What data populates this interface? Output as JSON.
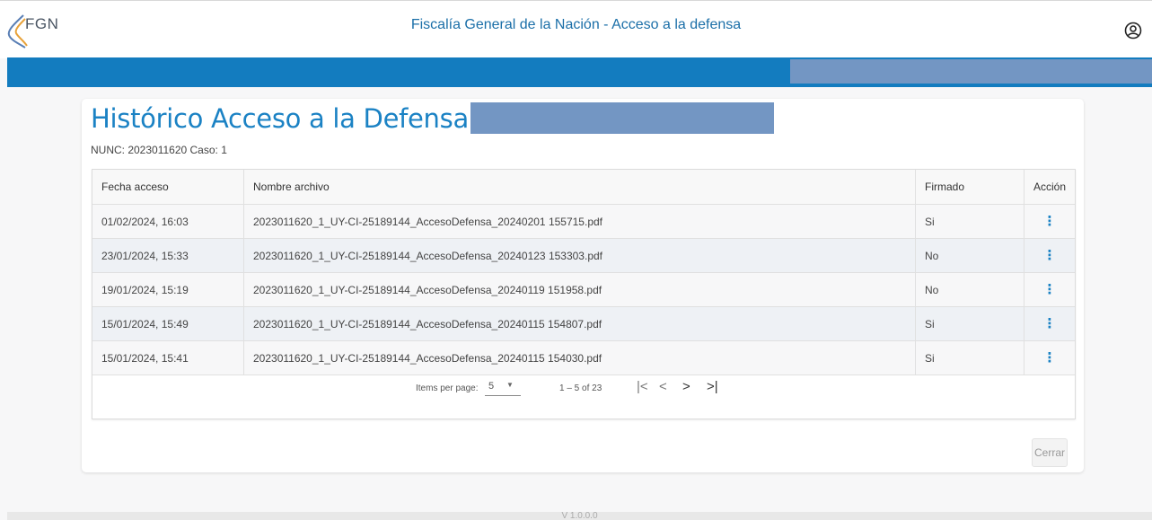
{
  "header": {
    "logo_text": "FGN",
    "title": "Fiscalía General de la Nación - Acceso a la defensa",
    "user_icon": "account-circle-icon"
  },
  "card": {
    "title": "Histórico Acceso a la Defensa para:",
    "subline": "NUNC: 2023011620 Caso: 1",
    "close_label": "Cerrar"
  },
  "table": {
    "columns": [
      "Fecha acceso",
      "Nombre archivo",
      "Firmado",
      "Acción"
    ],
    "rows": [
      {
        "fecha": "01/02/2024, 16:03",
        "archivo": "2023011620_1_UY-CI-25189144_AccesoDefensa_20240201 155715.pdf",
        "firmado": "Si",
        "accion": "⋮"
      },
      {
        "fecha": "23/01/2024, 15:33",
        "archivo": "2023011620_1_UY-CI-25189144_AccesoDefensa_20240123 153303.pdf",
        "firmado": "No",
        "accion": "⋮"
      },
      {
        "fecha": "19/01/2024, 15:19",
        "archivo": "2023011620_1_UY-CI-25189144_AccesoDefensa_20240119 151958.pdf",
        "firmado": "No",
        "accion": "⋮"
      },
      {
        "fecha": "15/01/2024, 15:49",
        "archivo": "2023011620_1_UY-CI-25189144_AccesoDefensa_20240115 154807.pdf",
        "firmado": "Si",
        "accion": "⋮"
      },
      {
        "fecha": "15/01/2024, 15:41",
        "archivo": "2023011620_1_UY-CI-25189144_AccesoDefensa_20240115 154030.pdf",
        "firmado": "Si",
        "accion": "⋮"
      }
    ]
  },
  "pager": {
    "items_label": "Items per page:",
    "page_size": "5",
    "range": "1 – 5 of 23",
    "first": "|<",
    "prev": "<",
    "next": ">",
    "last": ">|"
  },
  "footer": {
    "version": "V 1.0.0.0"
  },
  "colors": {
    "brand_blue": "#137cbf",
    "title_blue": "#1b82c4",
    "redaction": "#7396c3"
  }
}
